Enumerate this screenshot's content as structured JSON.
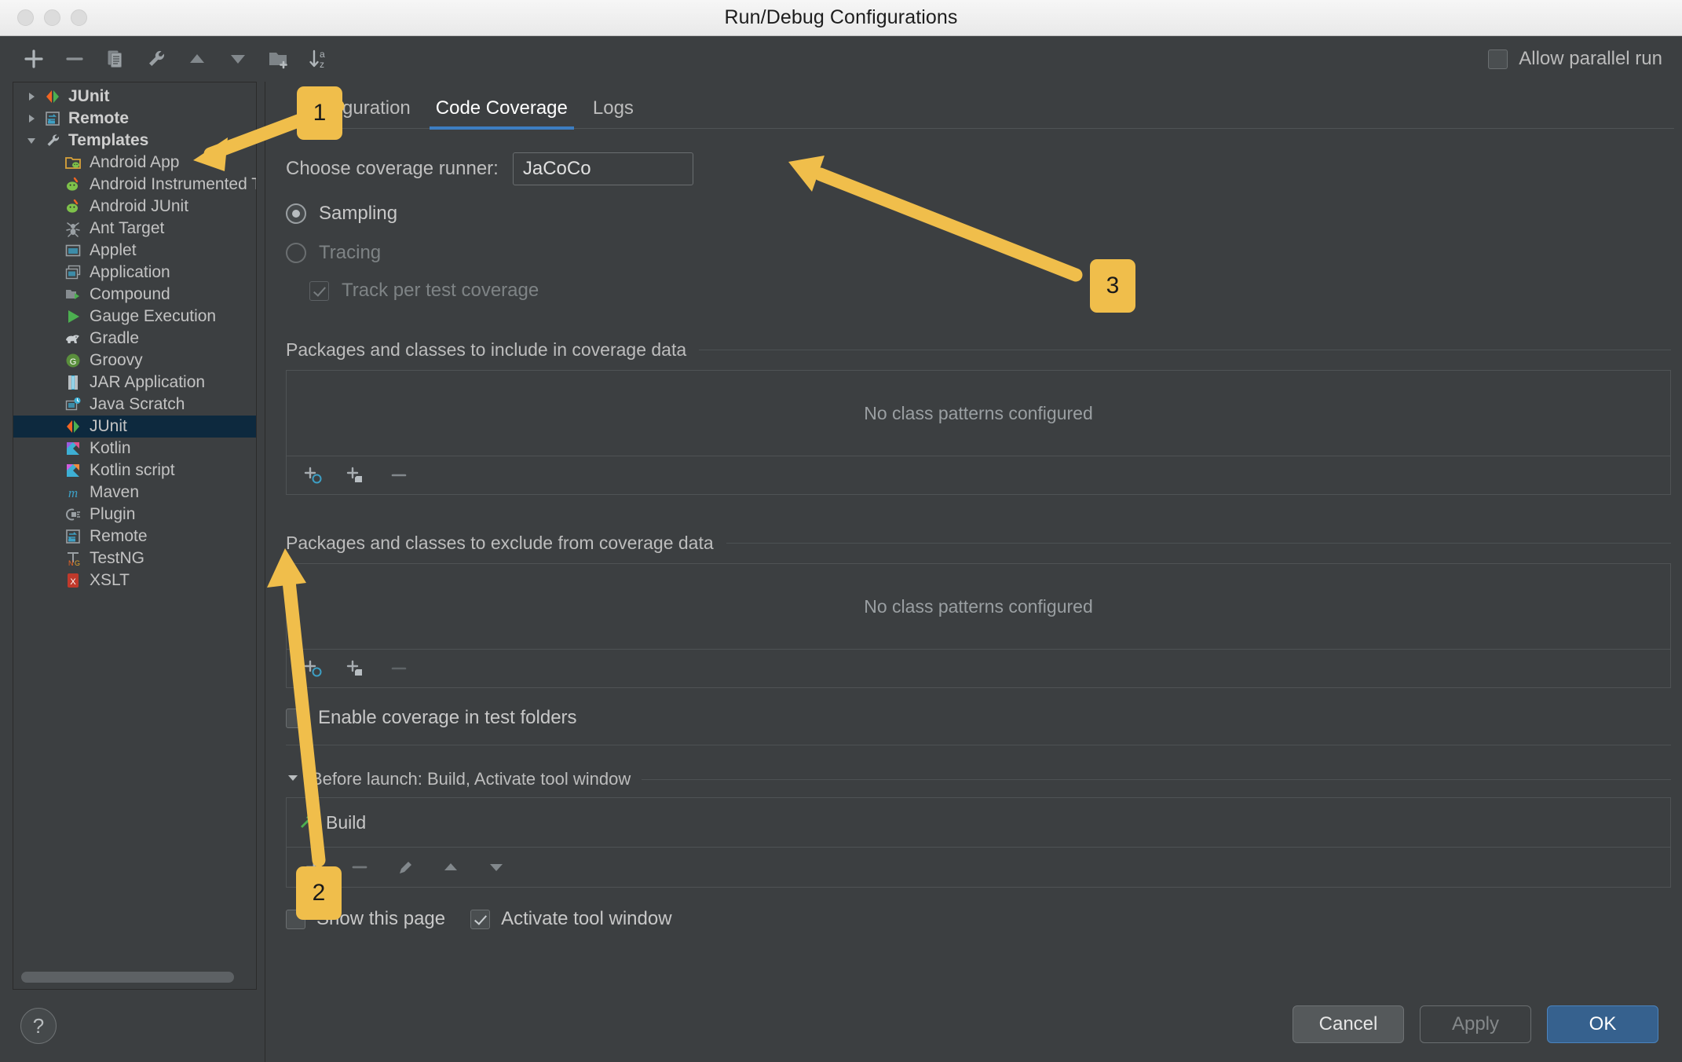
{
  "window": {
    "title": "Run/Debug Configurations"
  },
  "toolbar": {
    "icons": [
      "add-icon",
      "remove-icon",
      "copy-icon",
      "edit-templates-icon",
      "move-up-icon",
      "move-down-icon",
      "new-folder-icon",
      "sort-alphabetically-icon"
    ],
    "allow_parallel_run": {
      "label": "Allow parallel run",
      "checked": false
    }
  },
  "sidebar": {
    "roots": [
      {
        "label": "JUnit",
        "icon": "junit-icon",
        "expanded": false
      },
      {
        "label": "Remote",
        "icon": "remote-icon",
        "expanded": false
      },
      {
        "label": "Templates",
        "icon": "wrench-icon",
        "expanded": true
      }
    ],
    "templates": [
      {
        "label": "Android App",
        "icon": "android-app-icon",
        "selected": false
      },
      {
        "label": "Android Instrumented T…",
        "icon": "android-icon",
        "selected": false
      },
      {
        "label": "Android JUnit",
        "icon": "android-icon",
        "selected": false
      },
      {
        "label": "Ant Target",
        "icon": "ant-icon",
        "selected": false
      },
      {
        "label": "Applet",
        "icon": "applet-icon",
        "selected": false
      },
      {
        "label": "Application",
        "icon": "application-icon",
        "selected": false
      },
      {
        "label": "Compound",
        "icon": "compound-icon",
        "selected": false
      },
      {
        "label": "Gauge Execution",
        "icon": "run-icon",
        "selected": false
      },
      {
        "label": "Gradle",
        "icon": "gradle-icon",
        "selected": false
      },
      {
        "label": "Groovy",
        "icon": "groovy-icon",
        "selected": false
      },
      {
        "label": "JAR Application",
        "icon": "jar-icon",
        "selected": false
      },
      {
        "label": "Java Scratch",
        "icon": "java-scratch-icon",
        "selected": false
      },
      {
        "label": "JUnit",
        "icon": "junit-icon",
        "selected": true
      },
      {
        "label": "Kotlin",
        "icon": "kotlin-icon",
        "selected": false
      },
      {
        "label": "Kotlin script",
        "icon": "kotlin-icon",
        "selected": false
      },
      {
        "label": "Maven",
        "icon": "maven-icon",
        "selected": false
      },
      {
        "label": "Plugin",
        "icon": "plugin-icon",
        "selected": false
      },
      {
        "label": "Remote",
        "icon": "remote-icon",
        "selected": false
      },
      {
        "label": "TestNG",
        "icon": "testng-icon",
        "selected": false
      },
      {
        "label": "XSLT",
        "icon": "xslt-icon",
        "selected": false
      }
    ],
    "help_label": "?"
  },
  "tabs": [
    {
      "label": "Configuration",
      "active": false
    },
    {
      "label": "Code Coverage",
      "active": true
    },
    {
      "label": "Logs",
      "active": false
    }
  ],
  "coverage": {
    "runner_label": "Choose coverage runner:",
    "runner_value": "JaCoCo",
    "sampling": {
      "label": "Sampling",
      "selected": true
    },
    "tracing": {
      "label": "Tracing",
      "selected": false,
      "enabled": false
    },
    "track_per_test": {
      "label": "Track per test coverage",
      "checked": true,
      "enabled": false
    },
    "include_section": {
      "title": "Packages and classes to include in coverage data",
      "empty_text": "No class patterns configured",
      "toolbar": [
        "add-class-icon",
        "add-package-icon",
        "remove-icon"
      ]
    },
    "exclude_section": {
      "title": "Packages and classes to exclude from coverage data",
      "empty_text": "No class patterns configured",
      "toolbar": [
        "add-class-icon",
        "add-package-icon",
        "remove-icon"
      ]
    },
    "enable_test_folders": {
      "label": "Enable coverage in test folders",
      "checked": false
    }
  },
  "before_launch": {
    "header": "Before launch: Build, Activate tool window",
    "tasks": [
      {
        "label": "Build",
        "icon": "hammer-icon"
      }
    ],
    "toolbar": [
      "add-icon",
      "remove-icon",
      "edit-icon",
      "move-up-icon",
      "move-down-icon"
    ],
    "show_this_page": {
      "label": "Show this page",
      "checked": false
    },
    "activate_tool_window": {
      "label": "Activate tool window",
      "checked": true
    }
  },
  "footer": {
    "cancel": "Cancel",
    "apply": "Apply",
    "ok": "OK"
  },
  "annotations": [
    {
      "id": "1",
      "number": "1"
    },
    {
      "id": "2",
      "number": "2"
    },
    {
      "id": "3",
      "number": "3"
    }
  ],
  "colors": {
    "accent_blue": "#3d7ec2",
    "selection_blue": "#0d293e",
    "annotation_yellow": "#f0be4b",
    "window_bg": "#3c3f41",
    "ok_button": "#36618e"
  }
}
